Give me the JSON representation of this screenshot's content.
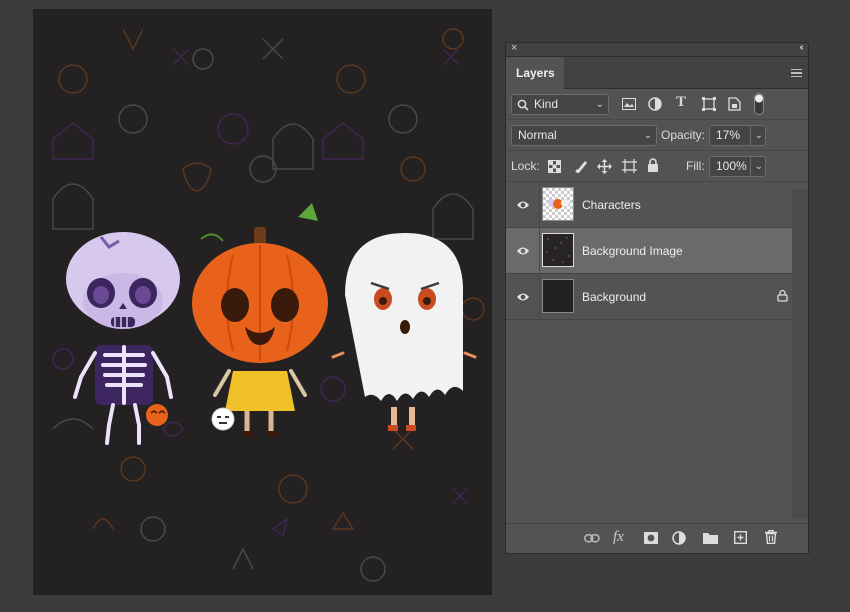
{
  "panel": {
    "close_glyph": "×",
    "collapse_glyph": "‹‹",
    "tab_label": "Layers",
    "filter": {
      "label": "Kind",
      "icon": "search-icon"
    },
    "filter_icons": [
      "image-filter-icon",
      "adjustment-filter-icon",
      "type-filter-icon",
      "shape-filter-icon",
      "smart-object-filter-icon",
      "filter-toggle-icon"
    ],
    "blend_mode": "Normal",
    "opacity_label": "Opacity:",
    "opacity_value": "17%",
    "lock_label": "Lock:",
    "lock_icons": [
      "lock-transparent-pixels-icon",
      "lock-image-pixels-icon",
      "lock-position-icon",
      "lock-artboard-icon",
      "lock-all-icon"
    ],
    "fill_label": "Fill:",
    "fill_value": "100%",
    "layers": [
      {
        "name": "Characters",
        "selected": false,
        "visible": true,
        "locked": false
      },
      {
        "name": "Background Image",
        "selected": true,
        "visible": true,
        "locked": false
      },
      {
        "name": "Background",
        "selected": false,
        "visible": true,
        "locked": true
      }
    ],
    "footer_icons": [
      "link-layers-icon",
      "fx-icon",
      "add-mask-icon",
      "adjustment-layer-icon",
      "new-group-icon",
      "new-layer-icon",
      "delete-layer-icon"
    ],
    "fx_label": "fx"
  },
  "colors": {
    "canvas_bg": "#232122",
    "panel_bg": "#535353",
    "selected_row": "#6a6a6a",
    "pumpkin": "#e8621c",
    "skull": "#d7c8ee",
    "ghost": "#f2f2f2"
  }
}
